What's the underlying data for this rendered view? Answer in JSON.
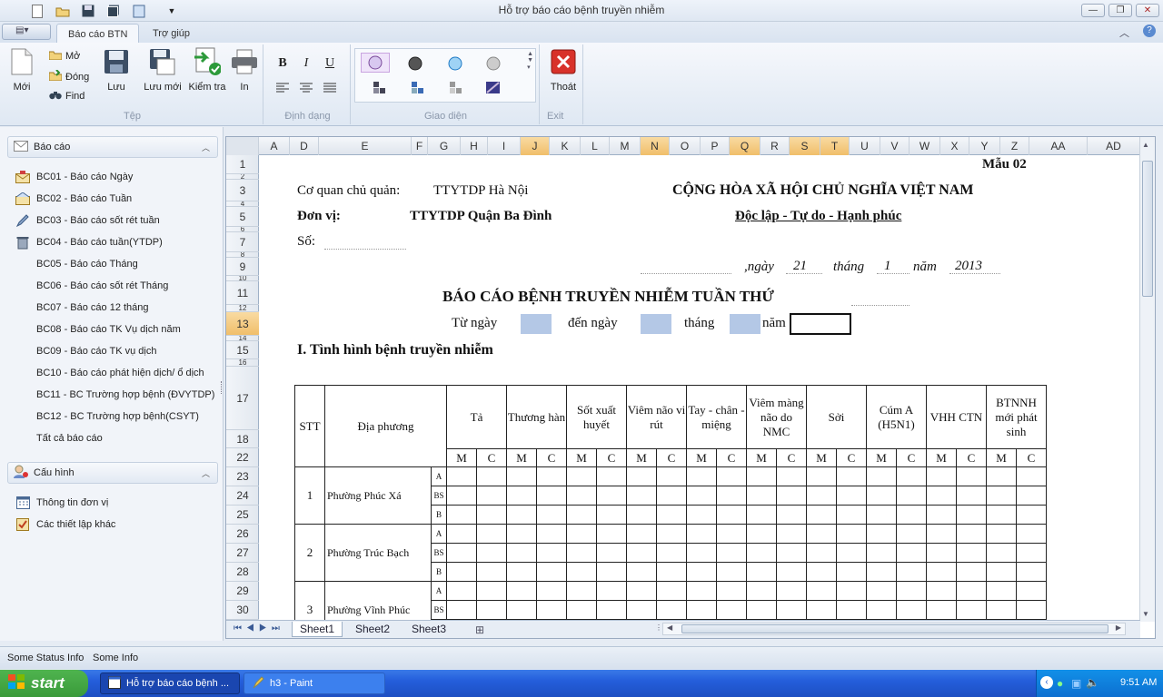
{
  "window": {
    "title": "Hỗ trợ báo cáo bệnh truyền nhiễm"
  },
  "ribbon": {
    "tabs": [
      {
        "label": "Báo cáo BTN",
        "active": true
      },
      {
        "label": "Trợ giúp",
        "active": false
      }
    ],
    "groups": {
      "tep": {
        "label": "Tệp",
        "moi": "Mới",
        "mo": "Mở",
        "dong": "Đóng",
        "find": "Find",
        "luu": "Lưu",
        "luu_moi": "Lưu mới",
        "kiem_tra": "Kiểm tra",
        "in": "In"
      },
      "dinh_dang": {
        "label": "Định dạng",
        "bold": "B",
        "italic": "I",
        "underline": "U"
      },
      "giao_dien": {
        "label": "Giao diện"
      },
      "exit": {
        "label": "Exit",
        "thoat": "Thoát"
      }
    }
  },
  "left_pane": {
    "bao_cao": {
      "header": "Báo cáo",
      "items": [
        "BC01 - Báo cáo Ngày",
        "BC02 - Báo cáo Tuần",
        "BC03 - Báo cáo sốt rét tuần",
        "BC04 - Báo cáo tuần(YTDP)",
        "BC05 - Báo cáo Tháng",
        "BC06 - Báo cáo sốt rét Tháng",
        "BC07 - Báo cáo 12 tháng",
        "BC08 - Báo cáo TK Vụ dịch năm",
        "BC09 - Báo cáo TK vụ dịch",
        "BC10 - Báo cáo phát hiện dịch/ ổ dịch",
        "BC11 - BC Trường hợp bệnh (ĐVYTDP)",
        "BC12 - BC Trường hợp bệnh(CSYT)",
        "Tất cả báo cáo"
      ]
    },
    "cau_hinh": {
      "header": "Cấu hình",
      "items": [
        "Thông tin đơn vị",
        "Các thiết lập khác"
      ]
    }
  },
  "sheet": {
    "columns": [
      "A",
      "D",
      "E",
      "F",
      "G",
      "H",
      "I",
      "J",
      "K",
      "L",
      "M",
      "N",
      "O",
      "P",
      "Q",
      "R",
      "S",
      "T",
      "U",
      "V",
      "W",
      "X",
      "Y",
      "Z",
      "AA",
      "AD"
    ],
    "rows": [
      "1",
      "2",
      "3",
      "4",
      "5",
      "6",
      "7",
      "8",
      "9",
      "10",
      "11",
      "12",
      "13",
      "14",
      "15",
      "16",
      "17",
      "18",
      "22",
      "23",
      "24",
      "25",
      "26",
      "27",
      "28",
      "29",
      "30"
    ],
    "tabs": [
      "Sheet1",
      "Sheet2",
      "Sheet3"
    ],
    "mau": "Mẫu 02",
    "co_quan_label": "Cơ quan chủ quản:",
    "co_quan_value": "TTYTDP Hà Nội",
    "quoc_hieu": "CỘNG HÒA XÃ HỘI CHỦ NGHĨA VIỆT NAM",
    "don_vi_label": "Đơn vị:",
    "don_vi_value": "TTYTDP Quận Ba Đình",
    "tieu_ngu": "Độc lập - Tự do - Hạnh phúc",
    "so_label": "Số:",
    "ngay_label": ",ngày",
    "ngay": "21",
    "thang_label": "tháng",
    "thang": "1",
    "nam_label": "năm",
    "nam": "2013",
    "report_title": "BÁO CÁO BỆNH TRUYỀN NHIỄM TUẦN THỨ",
    "tu_ngay": "Từ ngày",
    "den_ngay": "đến ngày",
    "thang2": "tháng",
    "nam2": "năm",
    "section1": "I. Tình hình bệnh truyền nhiễm",
    "table": {
      "stt": "STT",
      "dia_phuong": "Địa phương",
      "diseases": [
        "Tả",
        "Thương hàn",
        "Sốt xuất huyết",
        "Viêm não vi rút",
        "Tay - chân - miệng",
        "Viêm màng não do NMC",
        "Sởi",
        "Cúm A (H5N1)",
        "VHH CTN",
        "BTNNH mới phát sinh"
      ],
      "m": "M",
      "c": "C",
      "types": [
        "A",
        "BS",
        "B"
      ],
      "localities": [
        {
          "stt": "1",
          "name": "Phường Phúc Xá"
        },
        {
          "stt": "2",
          "name": "Phường Trúc Bạch"
        },
        {
          "stt": "3",
          "name": "Phường Vĩnh Phúc"
        }
      ]
    }
  },
  "status": {
    "info1": "Some Status Info",
    "info2": "Some Info"
  },
  "taskbar": {
    "start": "start",
    "tasks": [
      "Hỗ trợ báo cáo bệnh ...",
      "h3 - Paint"
    ],
    "clock": "9:51 AM"
  }
}
